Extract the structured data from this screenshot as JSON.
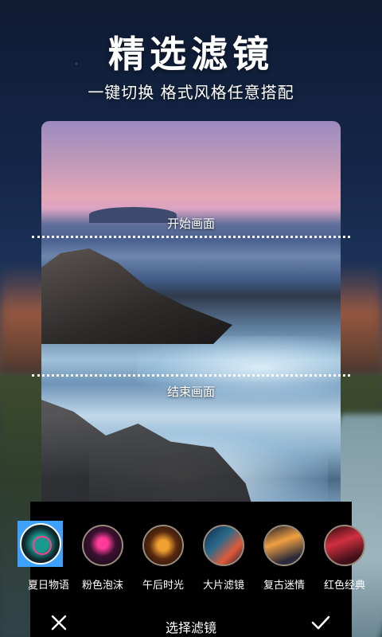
{
  "header": {
    "title": "精选滤镜",
    "subtitle": "一键切换 格式风格任意搭配"
  },
  "preview": {
    "start_label": "开始画面",
    "end_label": "结束画面"
  },
  "filters": {
    "selected_index": 0,
    "accent_color": "#3ea0ff",
    "items": [
      {
        "label": "夏日物语",
        "thumb": "neon-circle"
      },
      {
        "label": "粉色泡沫",
        "thumb": "pink-neon"
      },
      {
        "label": "午后时光",
        "thumb": "burger-neon"
      },
      {
        "label": "大片滤镜",
        "thumb": "city-night"
      },
      {
        "label": "复古迷情",
        "thumb": "retro-street"
      },
      {
        "label": "红色经典",
        "thumb": "red-sign"
      }
    ]
  },
  "bottom_bar": {
    "title": "选择滤镜",
    "close_icon": "close-icon",
    "confirm_icon": "check-icon"
  }
}
